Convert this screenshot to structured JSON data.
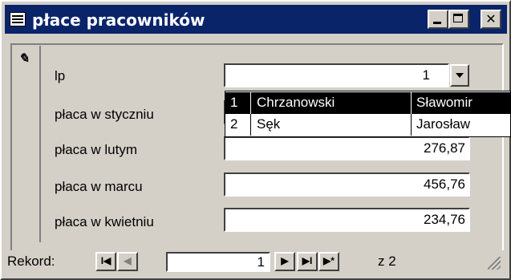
{
  "window": {
    "title": "płace pracowników"
  },
  "form": {
    "fields": [
      {
        "label": "lp",
        "value": "1"
      },
      {
        "label": "płaca w styczniu",
        "value": ""
      },
      {
        "label": "płaca w lutym",
        "value": "276,87"
      },
      {
        "label": "płaca w marcu",
        "value": "456,76"
      },
      {
        "label": "płaca w kwietniu",
        "value": "234,76"
      }
    ],
    "dropdown": [
      {
        "lp": "1",
        "surname": "Chrzanowski",
        "name": "Sławomir",
        "selected": true
      },
      {
        "lp": "2",
        "surname": "Sęk",
        "name": "Jarosław",
        "selected": false
      }
    ]
  },
  "navigation": {
    "label": "Rekord:",
    "first": "I◀",
    "prev": "◀",
    "current": "1",
    "next": "▶",
    "last": "▶I",
    "new": "▶*",
    "of": "z 2"
  }
}
